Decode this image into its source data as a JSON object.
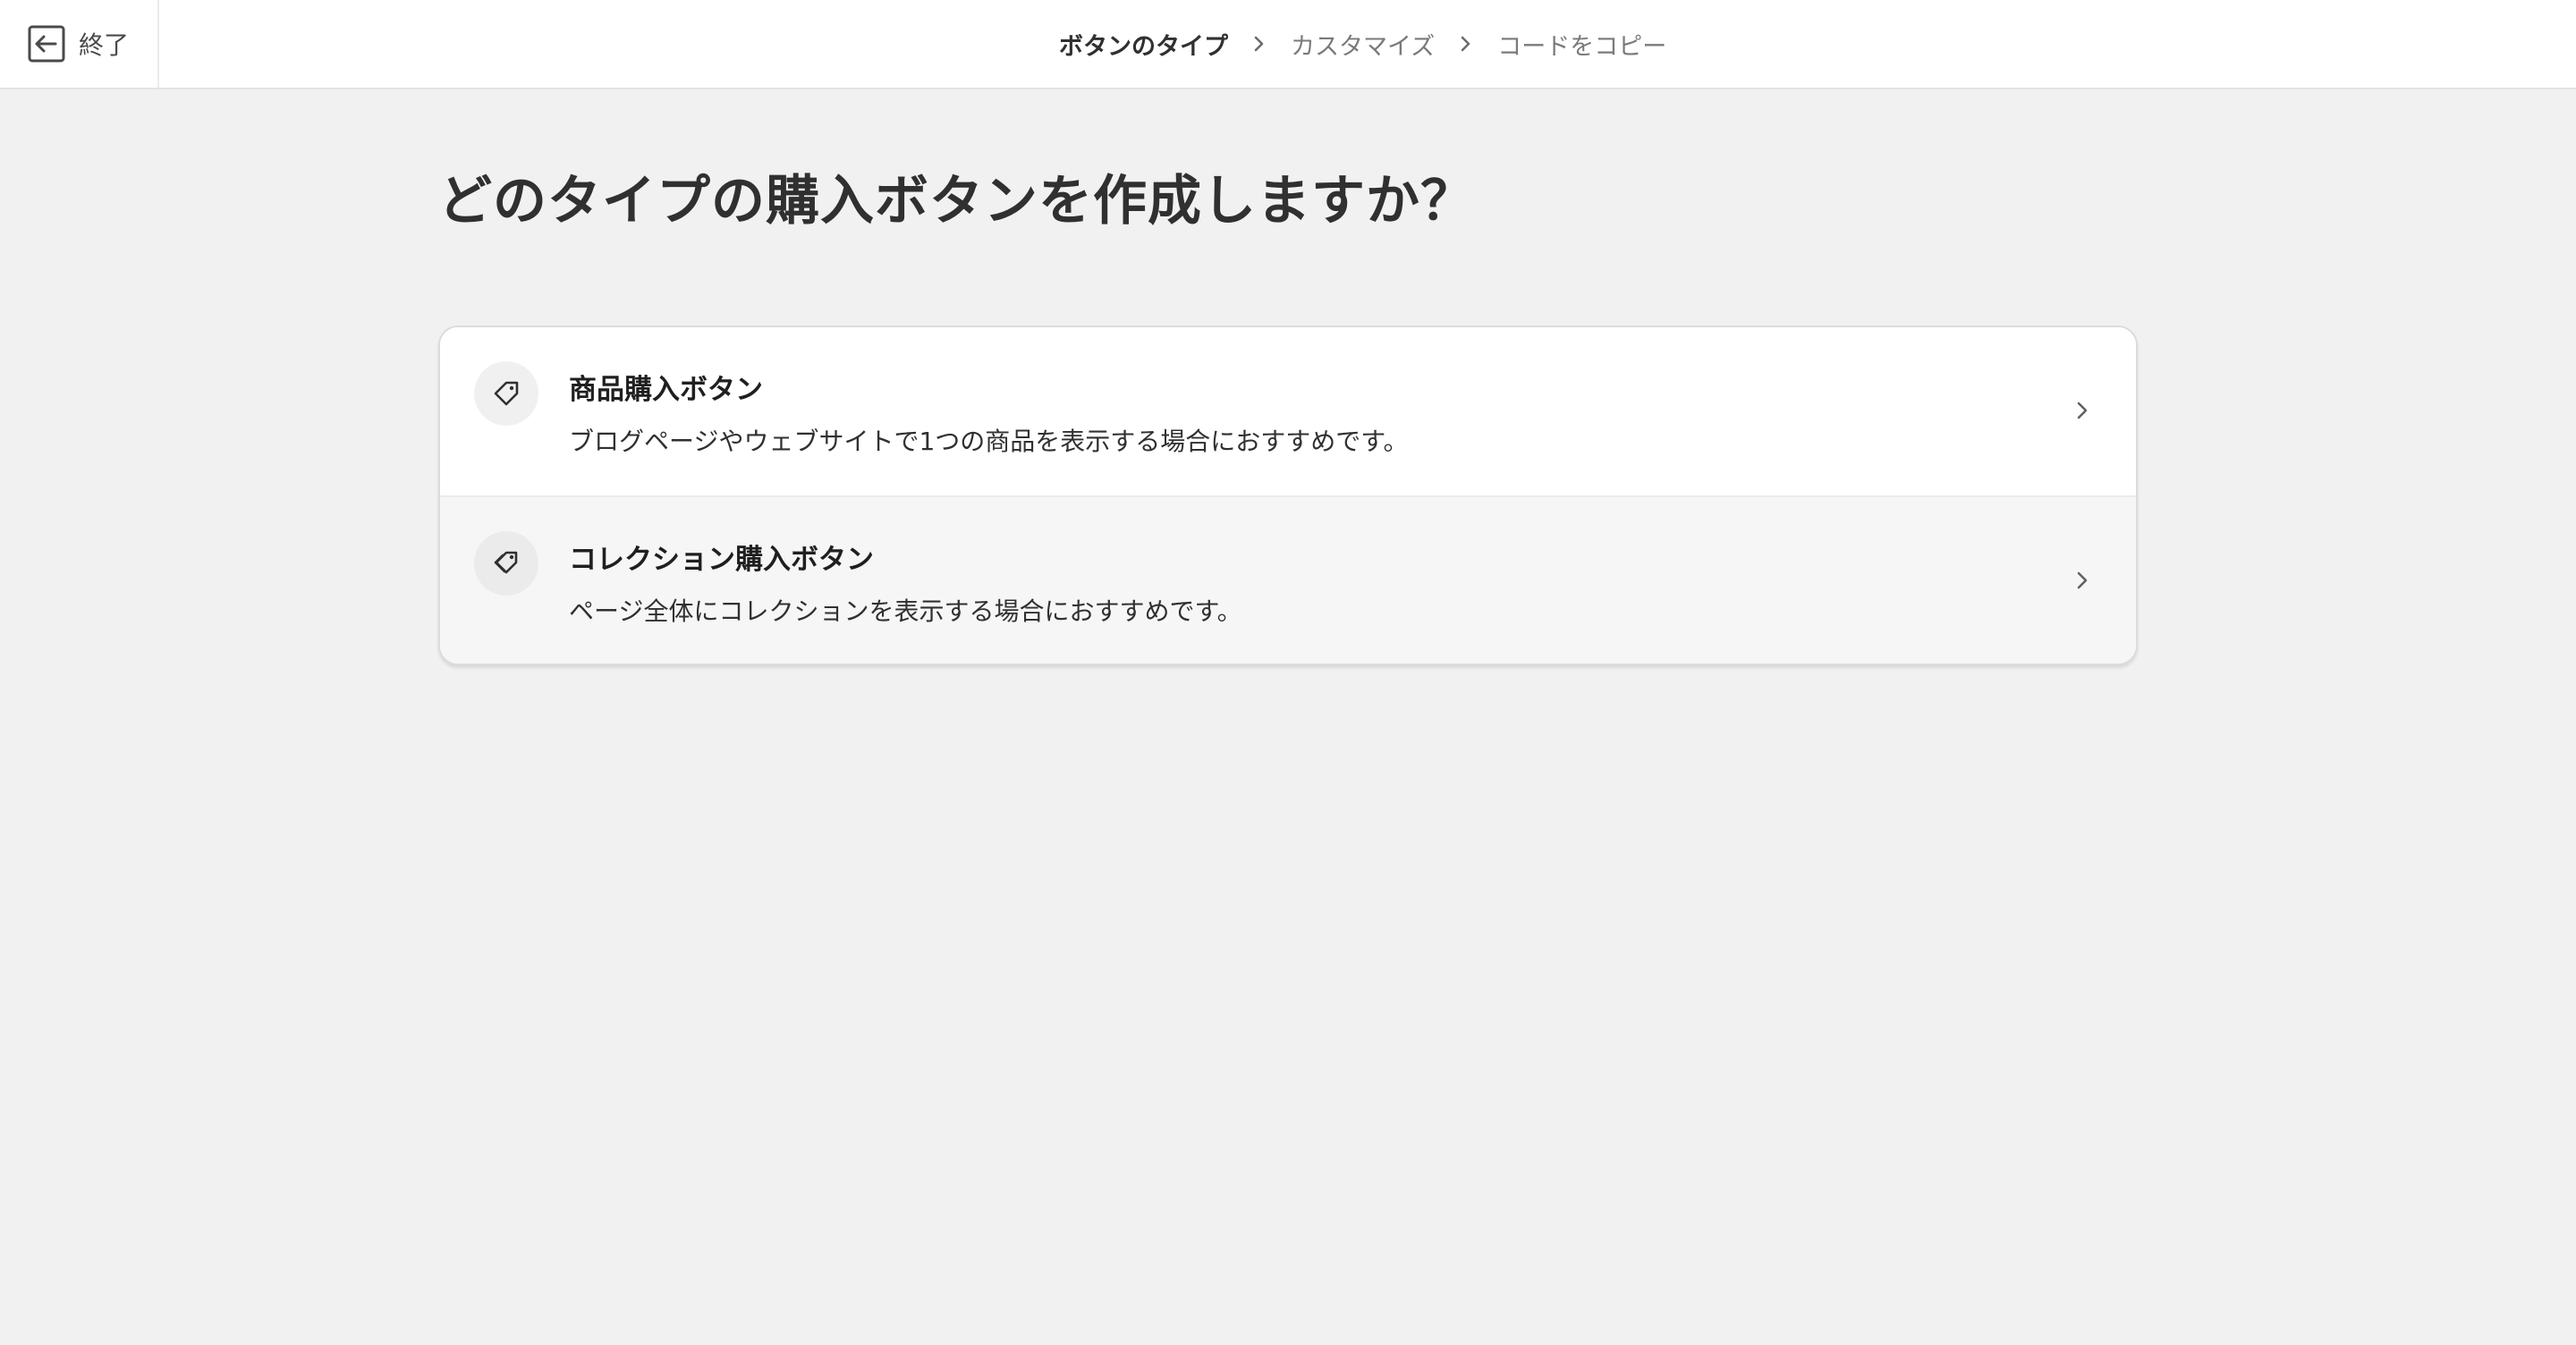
{
  "topbar": {
    "exit_label": "終了",
    "exit_icon": "exit-icon",
    "steps": [
      {
        "label": "ボタンのタイプ",
        "active": true
      },
      {
        "label": "カスタマイズ",
        "active": false
      },
      {
        "label": "コードをコピー",
        "active": false
      }
    ]
  },
  "main": {
    "title": "どのタイプの購入ボタンを作成しますか？",
    "options": [
      {
        "title": "商品購入ボタン",
        "description": "ブログページやウェブサイトで1つの商品を表示する場合におすすめです。",
        "icon": "price-tag-icon"
      },
      {
        "title": "コレクション購入ボタン",
        "description": "ページ全体にコレクションを表示する場合におすすめです。",
        "icon": "price-tags-icon"
      }
    ]
  },
  "colors": {
    "background": "#f1f1f1",
    "surface": "#ffffff",
    "text_primary": "#303030",
    "text_muted": "#7a7a7a"
  }
}
